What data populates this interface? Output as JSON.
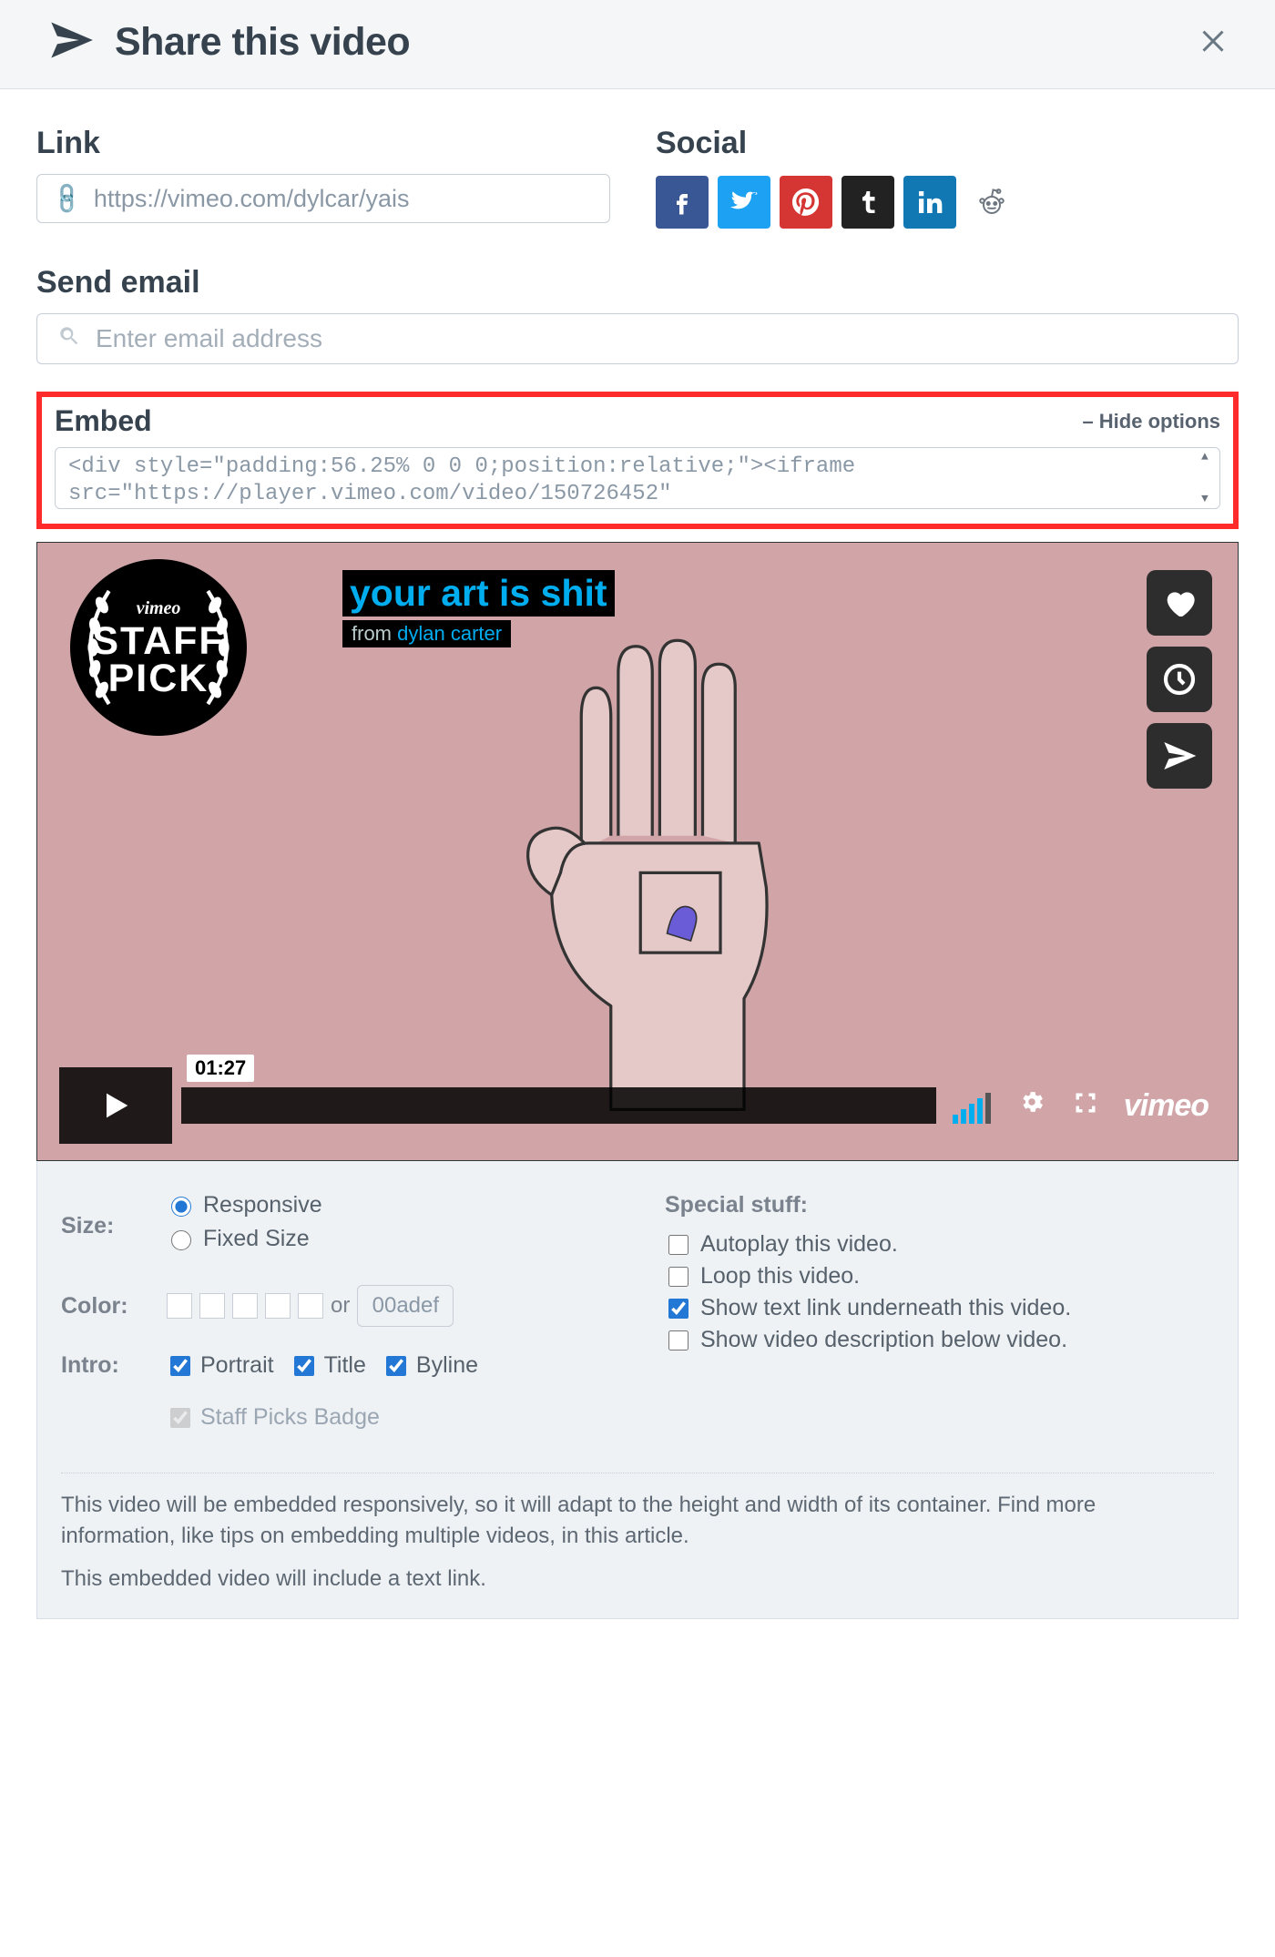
{
  "header": {
    "title": "Share this video"
  },
  "link": {
    "label": "Link",
    "value": "https://vimeo.com/dylcar/yais"
  },
  "social": {
    "label": "Social",
    "icons": [
      "facebook",
      "twitter",
      "pinterest",
      "tumblr",
      "linkedin",
      "reddit"
    ]
  },
  "email": {
    "label": "Send email",
    "placeholder": "Enter email address"
  },
  "embed": {
    "label": "Embed",
    "hide_label": "– Hide options",
    "code": "<div style=\"padding:56.25% 0 0 0;position:relative;\"><iframe\nsrc=\"https://player.vimeo.com/video/150726452\""
  },
  "preview": {
    "title": "your art is shit",
    "from_prefix": "from",
    "author": "dylan carter",
    "badge_line1": "vimeo",
    "badge_line2": "STAFF",
    "badge_line3": "PICK",
    "duration": "01:27",
    "logo": "vimeo"
  },
  "options": {
    "size_label": "Size:",
    "size_responsive": "Responsive",
    "size_fixed": "Fixed Size",
    "color_label": "Color:",
    "or": "or",
    "color_value": "00adef",
    "intro_label": "Intro:",
    "intro_portrait": "Portrait",
    "intro_title": "Title",
    "intro_byline": "Byline",
    "intro_staff": "Staff Picks Badge",
    "special_label": "Special stuff:",
    "spec_autoplay": "Autoplay this video.",
    "spec_loop": "Loop this video.",
    "spec_textlink": "Show text link underneath this video.",
    "spec_desc": "Show video description below video.",
    "footer_p1": "This video will be embedded responsively, so it will adapt to the height and width of its container. Find more information, like tips on embedding multiple videos, in this article.",
    "footer_p2": "This embedded video will include a text link."
  }
}
